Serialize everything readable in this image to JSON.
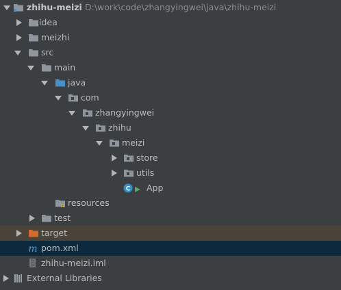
{
  "project_tree": {
    "root": {
      "label": "zhihu-meizi",
      "path": "D:\\work\\code\\zhangyingwei\\java\\zhihu-meizi"
    },
    "nodes": {
      "idea": "idea",
      "meizhi": "meizhi",
      "src": "src",
      "main": "main",
      "java": "java",
      "com": "com",
      "zhangyingwei": "zhangyingwei",
      "zhihu": "zhihu",
      "meizi": "meizi",
      "store": "store",
      "utils": "utils",
      "app": "App",
      "resources": "resources",
      "test": "test",
      "target": "target",
      "pom": "pom.xml",
      "iml": "zhihu-meizi.iml",
      "external_libraries": "External Libraries"
    },
    "icons": {
      "project": "module-folder-icon",
      "folder": "folder-icon",
      "source_folder": "source-root-folder-icon",
      "package": "package-icon",
      "resources": "resources-folder-icon",
      "excluded_folder": "excluded-folder-icon",
      "class": "java-class-icon",
      "maven": "maven-file-icon",
      "iml": "iml-file-icon",
      "libraries": "libraries-icon"
    },
    "selected_item": "pom.xml"
  },
  "colors": {
    "background": "#3c3f41",
    "selection": "#0d293e",
    "excluded_row": "#49433a",
    "text": "#bbbbbb",
    "path_text": "#8c8c8c",
    "folder": "#8e959c",
    "source_folder": "#4a90c8",
    "excluded_folder": "#d2692d",
    "class_icon": "#3592c4",
    "maven_icon": "#5a9bd4"
  }
}
